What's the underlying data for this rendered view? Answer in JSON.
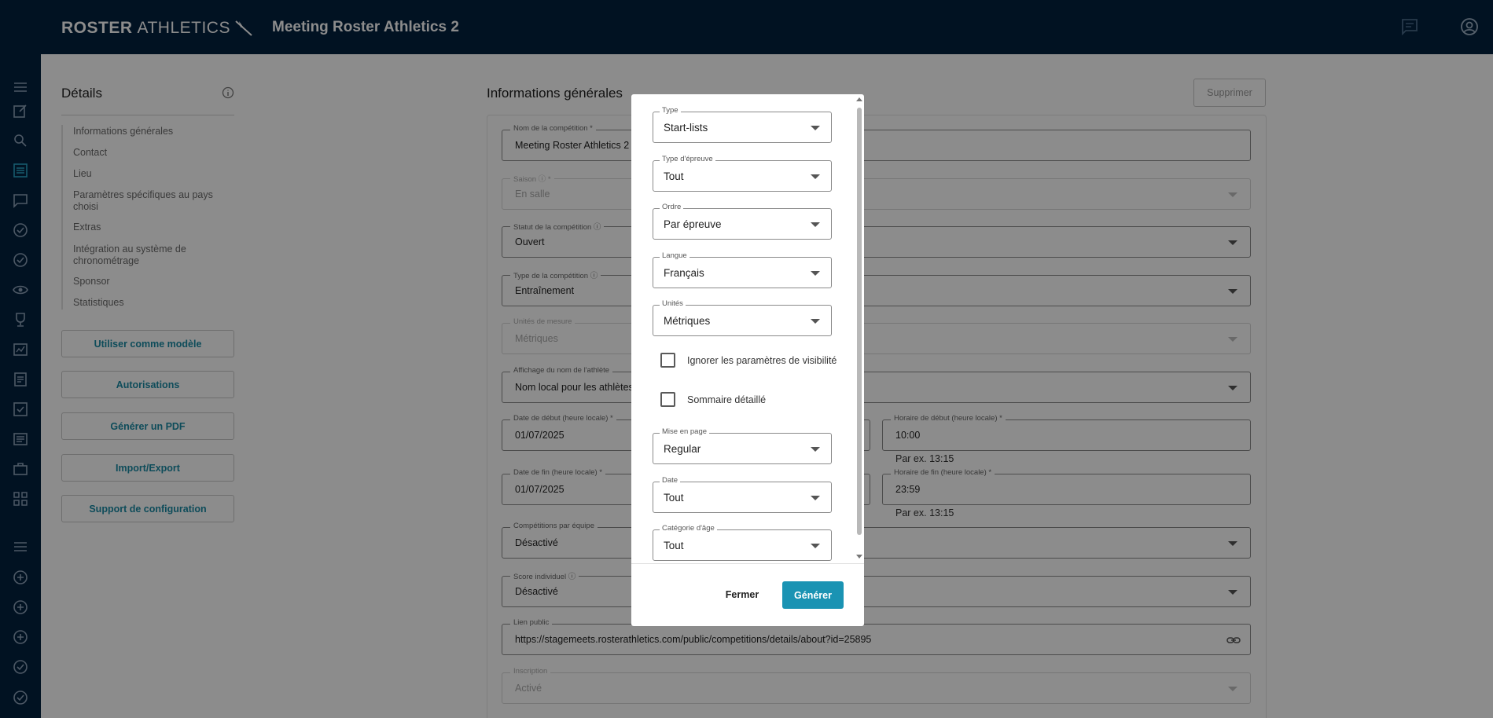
{
  "header": {
    "brand_bold": "ROSTER",
    "brand_light": "ATHLETICS",
    "meeting_title": "Meeting Roster Athletics 2"
  },
  "sidebar_icons": [
    "menu-icon",
    "edit-icon",
    "search-icon",
    "list-icon",
    "chat-icon",
    "check-circle-icon",
    "check-circle-icon",
    "eye-icon",
    "trophy-icon",
    "chart-icon",
    "document-icon",
    "checkbox-icon",
    "notes-icon",
    "briefcase-icon",
    "grid-icon",
    "menu-icon",
    "plus-circle-icon",
    "plus-circle-icon",
    "plus-circle-icon",
    "check-circle-icon",
    "check-circle-icon"
  ],
  "details": {
    "title": "Détails",
    "nav": [
      "Informations générales",
      "Contact",
      "Lieu",
      "Paramètres spécifiques au pays choisi",
      "Extras",
      "Intégration au système de chronométrage",
      "Sponsor",
      "Statistiques"
    ],
    "buttons": [
      "Utiliser comme modèle",
      "Autorisations",
      "Générer un PDF",
      "Import/Export",
      "Support de configuration"
    ]
  },
  "general": {
    "title": "Informations générales",
    "delete_label": "Supprimer",
    "fields": {
      "name": {
        "label": "Nom de la compétition *",
        "value": "Meeting Roster Athletics 2"
      },
      "season": {
        "label": "Saison ⓘ *",
        "value": "En salle"
      },
      "status": {
        "label": "Statut de la compétition ⓘ",
        "value": "Ouvert"
      },
      "type": {
        "label": "Type de la compétition ⓘ",
        "value": "Entraînement"
      },
      "units": {
        "label": "Unités de mesure",
        "value": "Métriques"
      },
      "athlete_name": {
        "label": "Affichage du nom de l'athlète",
        "value": "Nom local pour les athlètes"
      },
      "start_date": {
        "label": "Date de début (heure locale) *",
        "value": "01/07/2025"
      },
      "start_time": {
        "label": "Horaire de début (heure locale) *",
        "value": "10:00",
        "helper": "Par ex. 13:15"
      },
      "end_date": {
        "label": "Date de fin (heure locale) *",
        "value": "01/07/2025"
      },
      "end_time": {
        "label": "Horaire de fin (heure locale) *",
        "value": "23:59",
        "helper": "Par ex. 13:15"
      },
      "team": {
        "label": "Compétitions par équipe",
        "value": "Désactivé"
      },
      "score": {
        "label": "Score individuel ⓘ",
        "value": "Désactivé"
      },
      "public_link": {
        "label": "Lien public",
        "value": "https://stagemeets.rosterathletics.com/public/competitions/details/about?id=25895"
      },
      "registration": {
        "label": "Inscription",
        "value": "Activé"
      }
    }
  },
  "modal": {
    "fields": [
      {
        "label": "Type",
        "value": "Start-lists"
      },
      {
        "label": "Type d'épreuve",
        "value": "Tout"
      },
      {
        "label": "Ordre",
        "value": "Par épreuve"
      },
      {
        "label": "Langue",
        "value": "Français"
      },
      {
        "label": "Unités",
        "value": "Métriques"
      }
    ],
    "checkboxes": [
      {
        "label": "Ignorer les paramètres de visibilité",
        "checked": false
      },
      {
        "label": "Sommaire détaillé",
        "checked": false
      }
    ],
    "fields2": [
      {
        "label": "Mise en page",
        "value": "Regular"
      },
      {
        "label": "Date",
        "value": "Tout"
      },
      {
        "label": "Catégorie d'âge",
        "value": "Tout"
      }
    ],
    "close_label": "Fermer",
    "generate_label": "Générer"
  },
  "colors": {
    "navy": "#02213f",
    "accent": "#1a93b3"
  }
}
